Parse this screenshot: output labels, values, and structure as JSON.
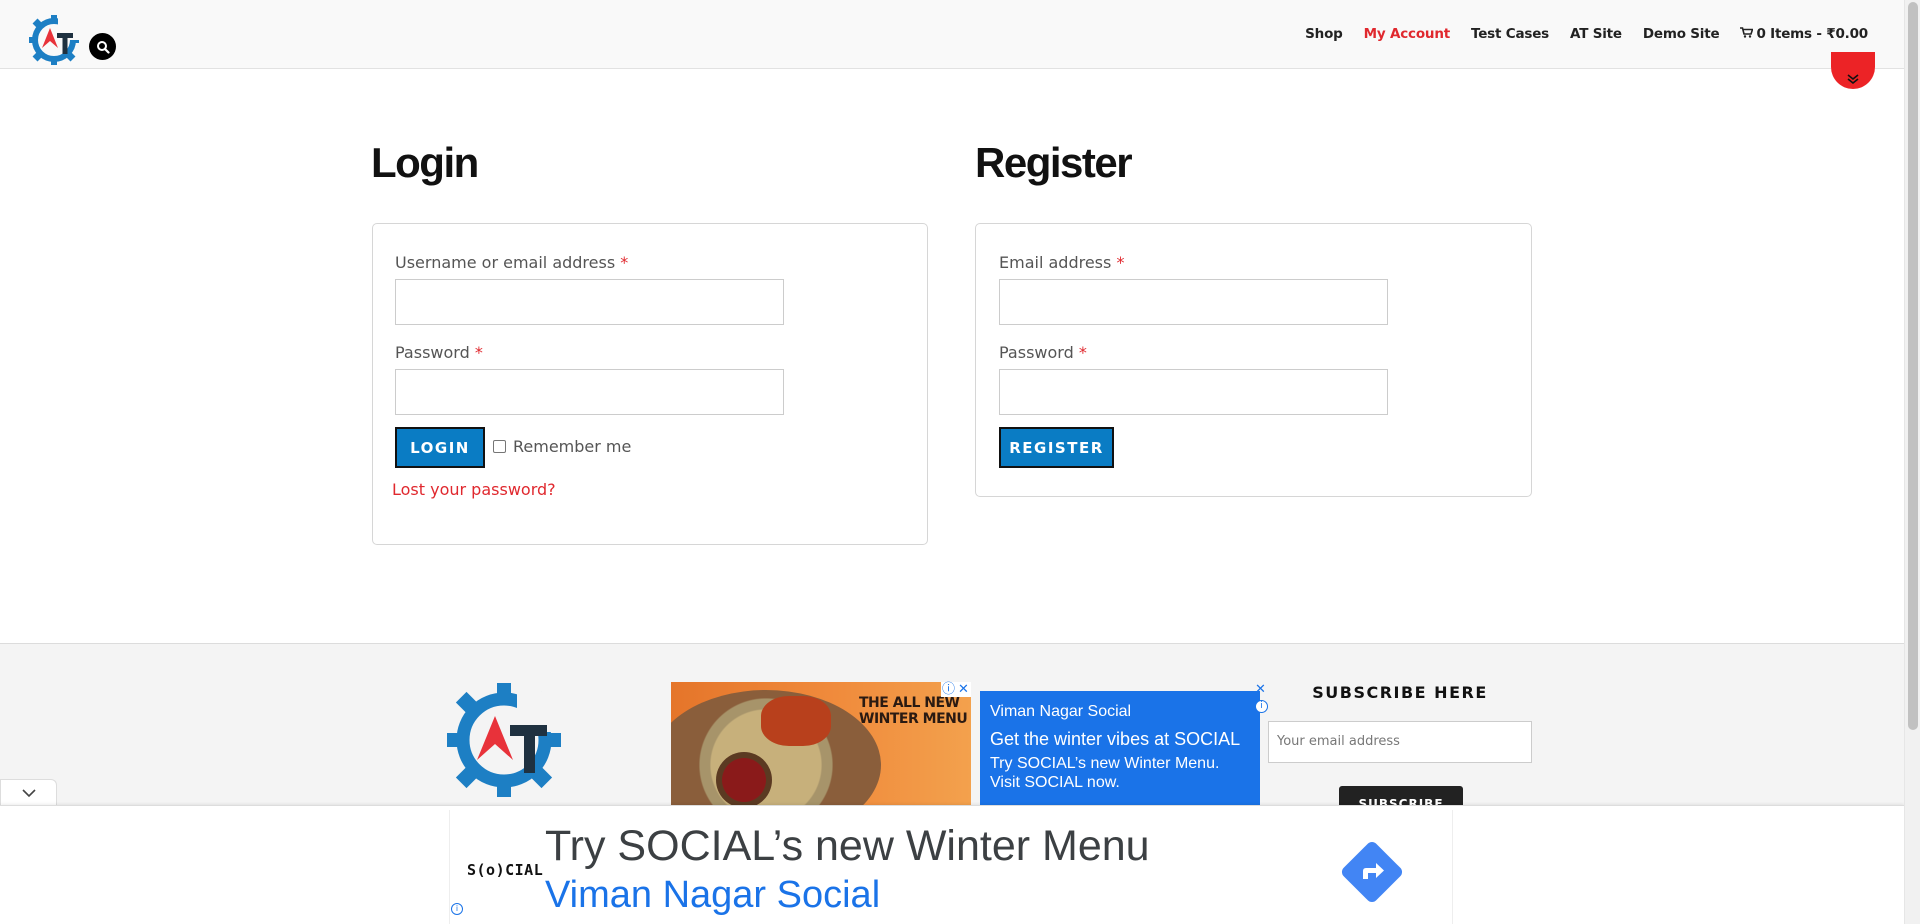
{
  "nav": {
    "items": [
      "Shop",
      "My Account",
      "Test Cases",
      "AT Site",
      "Demo Site"
    ],
    "active": "My Account",
    "cart_label": "0 Items - ₹0.00"
  },
  "login": {
    "title": "Login",
    "username_label": "Username or email address",
    "password_label": "Password",
    "required_mark": "*",
    "button_label": "LOGIN",
    "remember_label": "Remember me",
    "lost_password_label": "Lost your password?"
  },
  "register": {
    "title": "Register",
    "email_label": "Email address",
    "password_label": "Password",
    "required_mark": "*",
    "button_label": "REGISTER"
  },
  "footer": {
    "subscribe_title": "SUBSCRIBE HERE",
    "subscribe_placeholder": "Your email address",
    "subscribe_button": "SUBSCRIBE"
  },
  "ads": {
    "food_text": "THE ALL NEW WINTER MENU",
    "blue_header": "Viman Nagar Social",
    "blue_title": "Get the winter vibes at SOCIAL",
    "blue_desc": "Try SOCIAL’s new Winter Menu. Visit SOCIAL now.",
    "sticky_logo": "S(o)CIAL",
    "sticky_headline": "Try SOCIAL’s new Winter Menu",
    "sticky_sub": "Viman Nagar Social"
  },
  "colors": {
    "accent_red": "#e0282e",
    "button_blue": "#0a7cc4",
    "ad_blue": "#1a73e8"
  }
}
